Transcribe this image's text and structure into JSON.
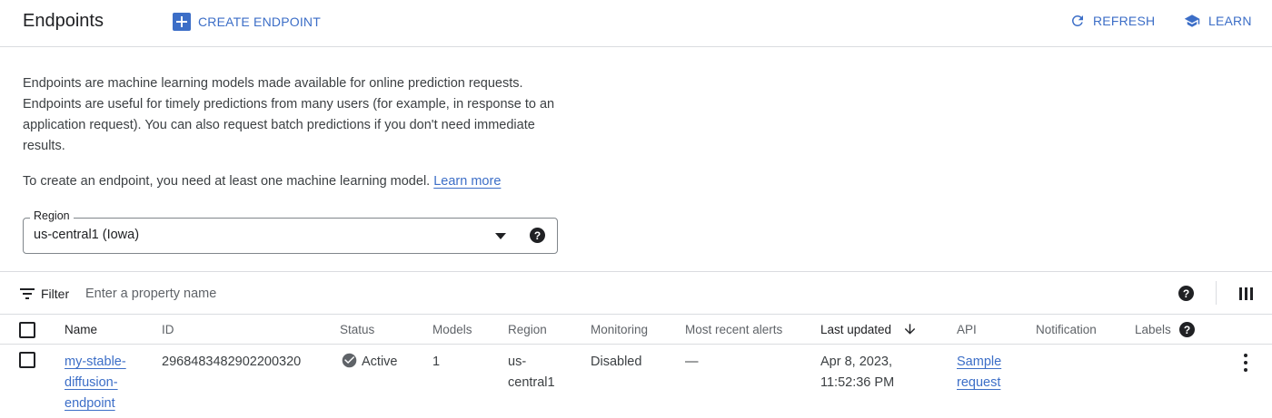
{
  "header": {
    "title": "Endpoints",
    "create_label": "CREATE ENDPOINT",
    "refresh_label": "REFRESH",
    "learn_label": "LEARN"
  },
  "description": {
    "paragraph": "Endpoints are machine learning models made available for online prediction requests. Endpoints are useful for timely predictions from many users (for example, in response to an application request). You can also request batch predictions if you don't need immediate results.",
    "note_prefix": "To create an endpoint, you need at least one machine learning model.",
    "learn_more": "Learn more"
  },
  "region": {
    "label": "Region",
    "value": "us-central1 (Iowa)"
  },
  "filter": {
    "label": "Filter",
    "placeholder": "Enter a property name"
  },
  "table": {
    "columns": {
      "name": "Name",
      "id": "ID",
      "status": "Status",
      "models": "Models",
      "region": "Region",
      "monitoring": "Monitoring",
      "alerts": "Most recent alerts",
      "last_updated": "Last updated",
      "api": "API",
      "notification": "Notification",
      "labels": "Labels"
    },
    "rows": [
      {
        "name_line1": "my-stable-",
        "name_line2": "diffusion-",
        "name_line3": "endpoint",
        "id": "2968483482902200320",
        "status": "Active",
        "models": "1",
        "region_line1": "us-",
        "region_line2": "central1",
        "monitoring": "Disabled",
        "alerts": "—",
        "updated_line1": "Apr 8, 2023,",
        "updated_line2": "11:52:36 PM",
        "api_line1": "Sample",
        "api_line2": "request"
      }
    ]
  },
  "colors": {
    "accent": "#3c6ec7",
    "border": "#dadce0",
    "text": "#202124"
  },
  "icons": {
    "create": "add-box-icon",
    "refresh": "refresh-icon",
    "learn": "school-icon",
    "filter": "filter-list-icon",
    "help": "help-icon",
    "columns": "column-view-icon",
    "status": "check-circle-icon",
    "sort": "arrow-downward-icon",
    "more": "more-vert-icon"
  }
}
